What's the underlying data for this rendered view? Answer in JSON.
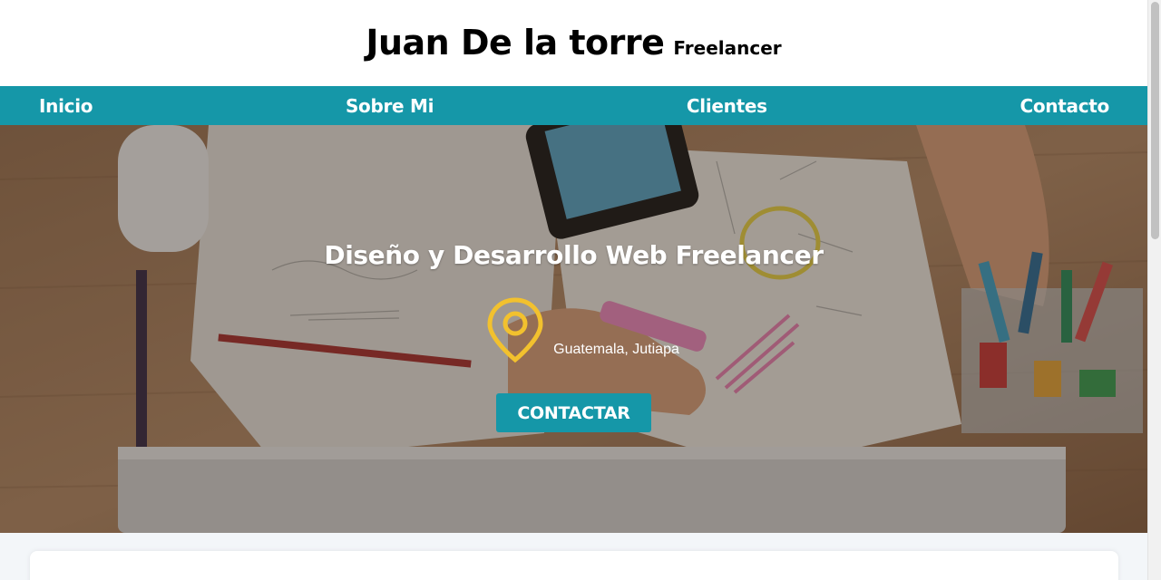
{
  "header": {
    "title": "Juan De la torre",
    "subtitle": "Freelancer"
  },
  "nav": {
    "items": [
      {
        "label": "Inicio"
      },
      {
        "label": "Sobre Mi"
      },
      {
        "label": "Clientes"
      },
      {
        "label": "Contacto"
      }
    ]
  },
  "hero": {
    "title": "Diseño y Desarrollo Web Freelancer",
    "location": "Guatemala, Jutiapa",
    "location_icon": "map-pin-icon",
    "cta_label": "CONTACTAR"
  },
  "colors": {
    "accent": "#1597a8",
    "pin": "#f2c12e",
    "header_bg": "#ffffff",
    "page_bg": "#f3f6f9"
  }
}
